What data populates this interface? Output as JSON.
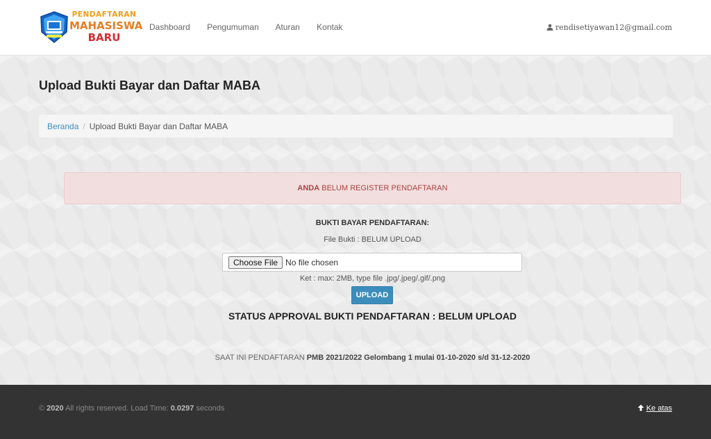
{
  "logo": {
    "line1": "PENDAFTARAN",
    "line2": "MAHASISWA",
    "line3": "BARU"
  },
  "nav": {
    "items": [
      "Dashboard",
      "Pengumuman",
      "Aturan",
      "Kontak"
    ]
  },
  "user": {
    "email": "rendisetiyawan12@gmail.com",
    "icon": "user-icon"
  },
  "page": {
    "title": "Upload Bukti Bayar dan Daftar MABA"
  },
  "breadcrumb": {
    "home": "Beranda",
    "separator": "/",
    "current": "Upload Bukti Bayar dan Daftar MABA"
  },
  "alert": {
    "strong": "ANDA",
    "text": " BELUM REGISTER PENDAFTARAN"
  },
  "form": {
    "heading": "BUKTI BAYAR PENDAFTARAN:",
    "file_status": "File Bukti : BELUM UPLOAD",
    "file_button": "Choose File",
    "file_placeholder": "No file chosen",
    "note": "Ket : max: 2MB, type file .jpg/.jpeg/.gif/.png",
    "upload_label": "UPLOAD",
    "status": "STATUS APPROVAL BUKTI PENDAFTARAN : BELUM UPLOAD"
  },
  "period": {
    "prefix": "SAAT INI PENDAFTARAN ",
    "strong": "PMB 2021/2022 Gelombang 1 mulai 01-10-2020 s/d 31-12-2020"
  },
  "footer": {
    "copy_prefix": "© ",
    "year": "2020",
    "copy_mid": " All rights reserved. Load Time: ",
    "load_time": "0.0297",
    "copy_suffix": " seconds",
    "back_to_top": "Ke atas"
  },
  "colors": {
    "primary": "#3c8dbc",
    "alert_bg": "#f2dede",
    "alert_text": "#a94442",
    "footer_bg": "#333333"
  }
}
